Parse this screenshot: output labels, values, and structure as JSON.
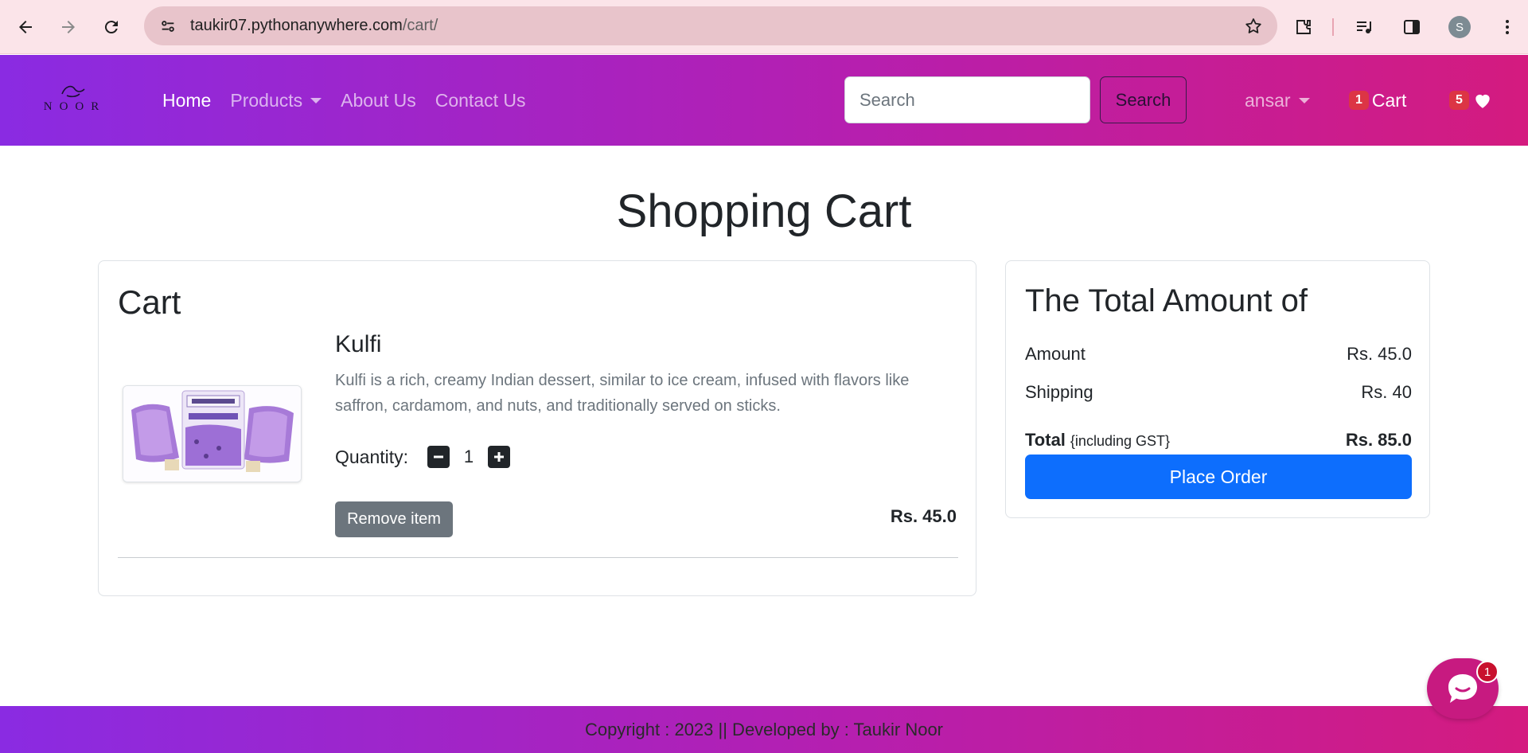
{
  "browser": {
    "url_host": "taukir07.pythonanywhere.com",
    "url_path": "/cart/",
    "profile_initial": "S"
  },
  "navbar": {
    "logo_text": "NOOR",
    "links": {
      "home": "Home",
      "products": "Products",
      "about": "About Us",
      "contact": "Contact Us"
    },
    "search_placeholder": "Search",
    "search_button": "Search",
    "user": "ansar",
    "cart_count": "1",
    "cart_label": "Cart",
    "wishlist_count": "5"
  },
  "page": {
    "title": "Shopping Cart"
  },
  "cart": {
    "heading": "Cart",
    "items": [
      {
        "name": "Kulfi",
        "description": "Kulfi is a rich, creamy Indian dessert, similar to ice cream, infused with flavors like saffron, cardamom, and nuts, and traditionally served on sticks.",
        "quantity_label": "Quantity:",
        "quantity": "1",
        "remove_label": "Remove item",
        "price": "Rs. 45.0"
      }
    ]
  },
  "summary": {
    "heading": "The Total Amount of",
    "amount_label": "Amount",
    "amount_value": "Rs. 45.0",
    "shipping_label": "Shipping",
    "shipping_value": "Rs. 40",
    "total_label": "Total",
    "total_note": "{including GST}",
    "total_value": "Rs. 85.0",
    "place_order": "Place Order"
  },
  "footer": {
    "text": "Copyright : 2023 || Developed by : Taukir Noor"
  },
  "chat": {
    "unread": "1"
  },
  "colors": {
    "nav_gradient_start": "#8a2be2",
    "nav_gradient_end": "#d41b7f",
    "primary": "#0d6efd",
    "badge": "#dc3545",
    "secondary": "#6c757d"
  }
}
